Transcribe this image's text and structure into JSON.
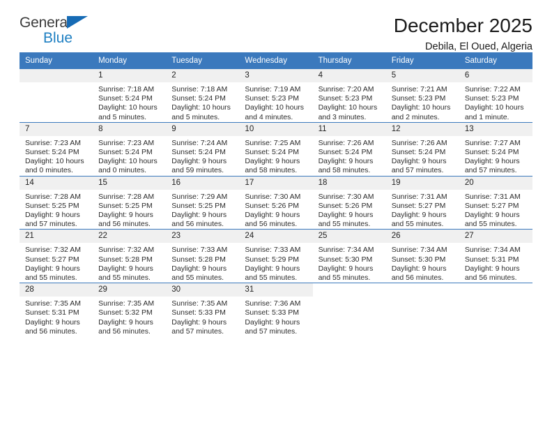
{
  "brand": {
    "name_part1": "General",
    "name_part2": "Blue",
    "logo_icon": "blue-triangle-icon",
    "colors": {
      "general": "#3c3c3c",
      "blue": "#1e7fc2",
      "triangle": "#166bb5"
    }
  },
  "header": {
    "title": "December 2025",
    "subtitle": "Debila, El Oued, Algeria"
  },
  "theme": {
    "header_row_bg": "#3b79bd",
    "day_number_bg": "#f0f0f0",
    "grid_line": "#3b79bd",
    "text": "#2b2b2b"
  },
  "weekdays": [
    "Sunday",
    "Monday",
    "Tuesday",
    "Wednesday",
    "Thursday",
    "Friday",
    "Saturday"
  ],
  "weeks": [
    [
      {
        "day": "",
        "sunrise": "",
        "sunset": "",
        "daylight1": "",
        "daylight2": "",
        "empty": true
      },
      {
        "day": "1",
        "sunrise": "Sunrise: 7:18 AM",
        "sunset": "Sunset: 5:24 PM",
        "daylight1": "Daylight: 10 hours",
        "daylight2": "and 5 minutes."
      },
      {
        "day": "2",
        "sunrise": "Sunrise: 7:18 AM",
        "sunset": "Sunset: 5:24 PM",
        "daylight1": "Daylight: 10 hours",
        "daylight2": "and 5 minutes."
      },
      {
        "day": "3",
        "sunrise": "Sunrise: 7:19 AM",
        "sunset": "Sunset: 5:23 PM",
        "daylight1": "Daylight: 10 hours",
        "daylight2": "and 4 minutes."
      },
      {
        "day": "4",
        "sunrise": "Sunrise: 7:20 AM",
        "sunset": "Sunset: 5:23 PM",
        "daylight1": "Daylight: 10 hours",
        "daylight2": "and 3 minutes."
      },
      {
        "day": "5",
        "sunrise": "Sunrise: 7:21 AM",
        "sunset": "Sunset: 5:23 PM",
        "daylight1": "Daylight: 10 hours",
        "daylight2": "and 2 minutes."
      },
      {
        "day": "6",
        "sunrise": "Sunrise: 7:22 AM",
        "sunset": "Sunset: 5:23 PM",
        "daylight1": "Daylight: 10 hours",
        "daylight2": "and 1 minute."
      }
    ],
    [
      {
        "day": "7",
        "sunrise": "Sunrise: 7:23 AM",
        "sunset": "Sunset: 5:24 PM",
        "daylight1": "Daylight: 10 hours",
        "daylight2": "and 0 minutes."
      },
      {
        "day": "8",
        "sunrise": "Sunrise: 7:23 AM",
        "sunset": "Sunset: 5:24 PM",
        "daylight1": "Daylight: 10 hours",
        "daylight2": "and 0 minutes."
      },
      {
        "day": "9",
        "sunrise": "Sunrise: 7:24 AM",
        "sunset": "Sunset: 5:24 PM",
        "daylight1": "Daylight: 9 hours",
        "daylight2": "and 59 minutes."
      },
      {
        "day": "10",
        "sunrise": "Sunrise: 7:25 AM",
        "sunset": "Sunset: 5:24 PM",
        "daylight1": "Daylight: 9 hours",
        "daylight2": "and 58 minutes."
      },
      {
        "day": "11",
        "sunrise": "Sunrise: 7:26 AM",
        "sunset": "Sunset: 5:24 PM",
        "daylight1": "Daylight: 9 hours",
        "daylight2": "and 58 minutes."
      },
      {
        "day": "12",
        "sunrise": "Sunrise: 7:26 AM",
        "sunset": "Sunset: 5:24 PM",
        "daylight1": "Daylight: 9 hours",
        "daylight2": "and 57 minutes."
      },
      {
        "day": "13",
        "sunrise": "Sunrise: 7:27 AM",
        "sunset": "Sunset: 5:24 PM",
        "daylight1": "Daylight: 9 hours",
        "daylight2": "and 57 minutes."
      }
    ],
    [
      {
        "day": "14",
        "sunrise": "Sunrise: 7:28 AM",
        "sunset": "Sunset: 5:25 PM",
        "daylight1": "Daylight: 9 hours",
        "daylight2": "and 57 minutes."
      },
      {
        "day": "15",
        "sunrise": "Sunrise: 7:28 AM",
        "sunset": "Sunset: 5:25 PM",
        "daylight1": "Daylight: 9 hours",
        "daylight2": "and 56 minutes."
      },
      {
        "day": "16",
        "sunrise": "Sunrise: 7:29 AM",
        "sunset": "Sunset: 5:25 PM",
        "daylight1": "Daylight: 9 hours",
        "daylight2": "and 56 minutes."
      },
      {
        "day": "17",
        "sunrise": "Sunrise: 7:30 AM",
        "sunset": "Sunset: 5:26 PM",
        "daylight1": "Daylight: 9 hours",
        "daylight2": "and 56 minutes."
      },
      {
        "day": "18",
        "sunrise": "Sunrise: 7:30 AM",
        "sunset": "Sunset: 5:26 PM",
        "daylight1": "Daylight: 9 hours",
        "daylight2": "and 55 minutes."
      },
      {
        "day": "19",
        "sunrise": "Sunrise: 7:31 AM",
        "sunset": "Sunset: 5:27 PM",
        "daylight1": "Daylight: 9 hours",
        "daylight2": "and 55 minutes."
      },
      {
        "day": "20",
        "sunrise": "Sunrise: 7:31 AM",
        "sunset": "Sunset: 5:27 PM",
        "daylight1": "Daylight: 9 hours",
        "daylight2": "and 55 minutes."
      }
    ],
    [
      {
        "day": "21",
        "sunrise": "Sunrise: 7:32 AM",
        "sunset": "Sunset: 5:27 PM",
        "daylight1": "Daylight: 9 hours",
        "daylight2": "and 55 minutes."
      },
      {
        "day": "22",
        "sunrise": "Sunrise: 7:32 AM",
        "sunset": "Sunset: 5:28 PM",
        "daylight1": "Daylight: 9 hours",
        "daylight2": "and 55 minutes."
      },
      {
        "day": "23",
        "sunrise": "Sunrise: 7:33 AM",
        "sunset": "Sunset: 5:28 PM",
        "daylight1": "Daylight: 9 hours",
        "daylight2": "and 55 minutes."
      },
      {
        "day": "24",
        "sunrise": "Sunrise: 7:33 AM",
        "sunset": "Sunset: 5:29 PM",
        "daylight1": "Daylight: 9 hours",
        "daylight2": "and 55 minutes."
      },
      {
        "day": "25",
        "sunrise": "Sunrise: 7:34 AM",
        "sunset": "Sunset: 5:30 PM",
        "daylight1": "Daylight: 9 hours",
        "daylight2": "and 55 minutes."
      },
      {
        "day": "26",
        "sunrise": "Sunrise: 7:34 AM",
        "sunset": "Sunset: 5:30 PM",
        "daylight1": "Daylight: 9 hours",
        "daylight2": "and 56 minutes."
      },
      {
        "day": "27",
        "sunrise": "Sunrise: 7:34 AM",
        "sunset": "Sunset: 5:31 PM",
        "daylight1": "Daylight: 9 hours",
        "daylight2": "and 56 minutes."
      }
    ],
    [
      {
        "day": "28",
        "sunrise": "Sunrise: 7:35 AM",
        "sunset": "Sunset: 5:31 PM",
        "daylight1": "Daylight: 9 hours",
        "daylight2": "and 56 minutes."
      },
      {
        "day": "29",
        "sunrise": "Sunrise: 7:35 AM",
        "sunset": "Sunset: 5:32 PM",
        "daylight1": "Daylight: 9 hours",
        "daylight2": "and 56 minutes."
      },
      {
        "day": "30",
        "sunrise": "Sunrise: 7:35 AM",
        "sunset": "Sunset: 5:33 PM",
        "daylight1": "Daylight: 9 hours",
        "daylight2": "and 57 minutes."
      },
      {
        "day": "31",
        "sunrise": "Sunrise: 7:36 AM",
        "sunset": "Sunset: 5:33 PM",
        "daylight1": "Daylight: 9 hours",
        "daylight2": "and 57 minutes."
      },
      {
        "day": "",
        "sunrise": "",
        "sunset": "",
        "daylight1": "",
        "daylight2": "",
        "blank": true
      },
      {
        "day": "",
        "sunrise": "",
        "sunset": "",
        "daylight1": "",
        "daylight2": "",
        "blank": true
      },
      {
        "day": "",
        "sunrise": "",
        "sunset": "",
        "daylight1": "",
        "daylight2": "",
        "blank": true
      }
    ]
  ]
}
